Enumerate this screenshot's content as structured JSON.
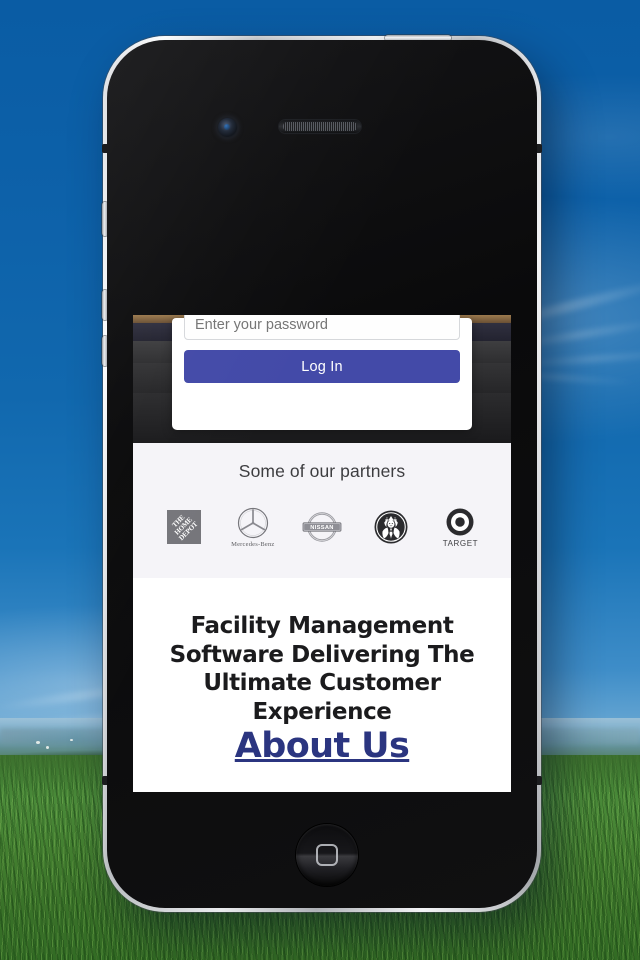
{
  "background": {
    "scene_description": "blue sky over green grass field",
    "sky_color": "#0d61a9",
    "grass_color": "#437f30"
  },
  "device": {
    "name": "smartphone-mockup",
    "bezel_color": "#0b0b0c",
    "frame_color": "#d8dadd",
    "hardware": {
      "camera": "front-camera-icon",
      "speaker": "earpiece-speaker-icon",
      "home_button": "home-button-icon",
      "mute_switch": "mute-switch-button",
      "volume_up": "volume-up-button",
      "volume_down": "volume-down-button",
      "power": "power-button"
    }
  },
  "screen": {
    "hero": {
      "login_card": {
        "password_placeholder": "Enter your password",
        "password_value": "",
        "login_label": "Log In",
        "login_button_color": "#434aa8"
      }
    },
    "partners": {
      "title": "Some of our partners",
      "background_color": "#f5f4f8",
      "logos": [
        {
          "name": "home-depot-logo",
          "caption": "",
          "mark_text": "THE HOME DEPOT"
        },
        {
          "name": "mercedes-benz-logo",
          "caption": "Mercedes-Benz"
        },
        {
          "name": "nissan-logo",
          "caption": ""
        },
        {
          "name": "starbucks-logo",
          "caption": ""
        },
        {
          "name": "target-logo",
          "caption": "TARGET"
        }
      ]
    },
    "pitch": {
      "headline": "Facility Management Software Delivering The Ultimate Customer Experience",
      "about_link": "About Us",
      "about_color": "#2b3580",
      "headline_color": "#1b1b1d"
    }
  }
}
